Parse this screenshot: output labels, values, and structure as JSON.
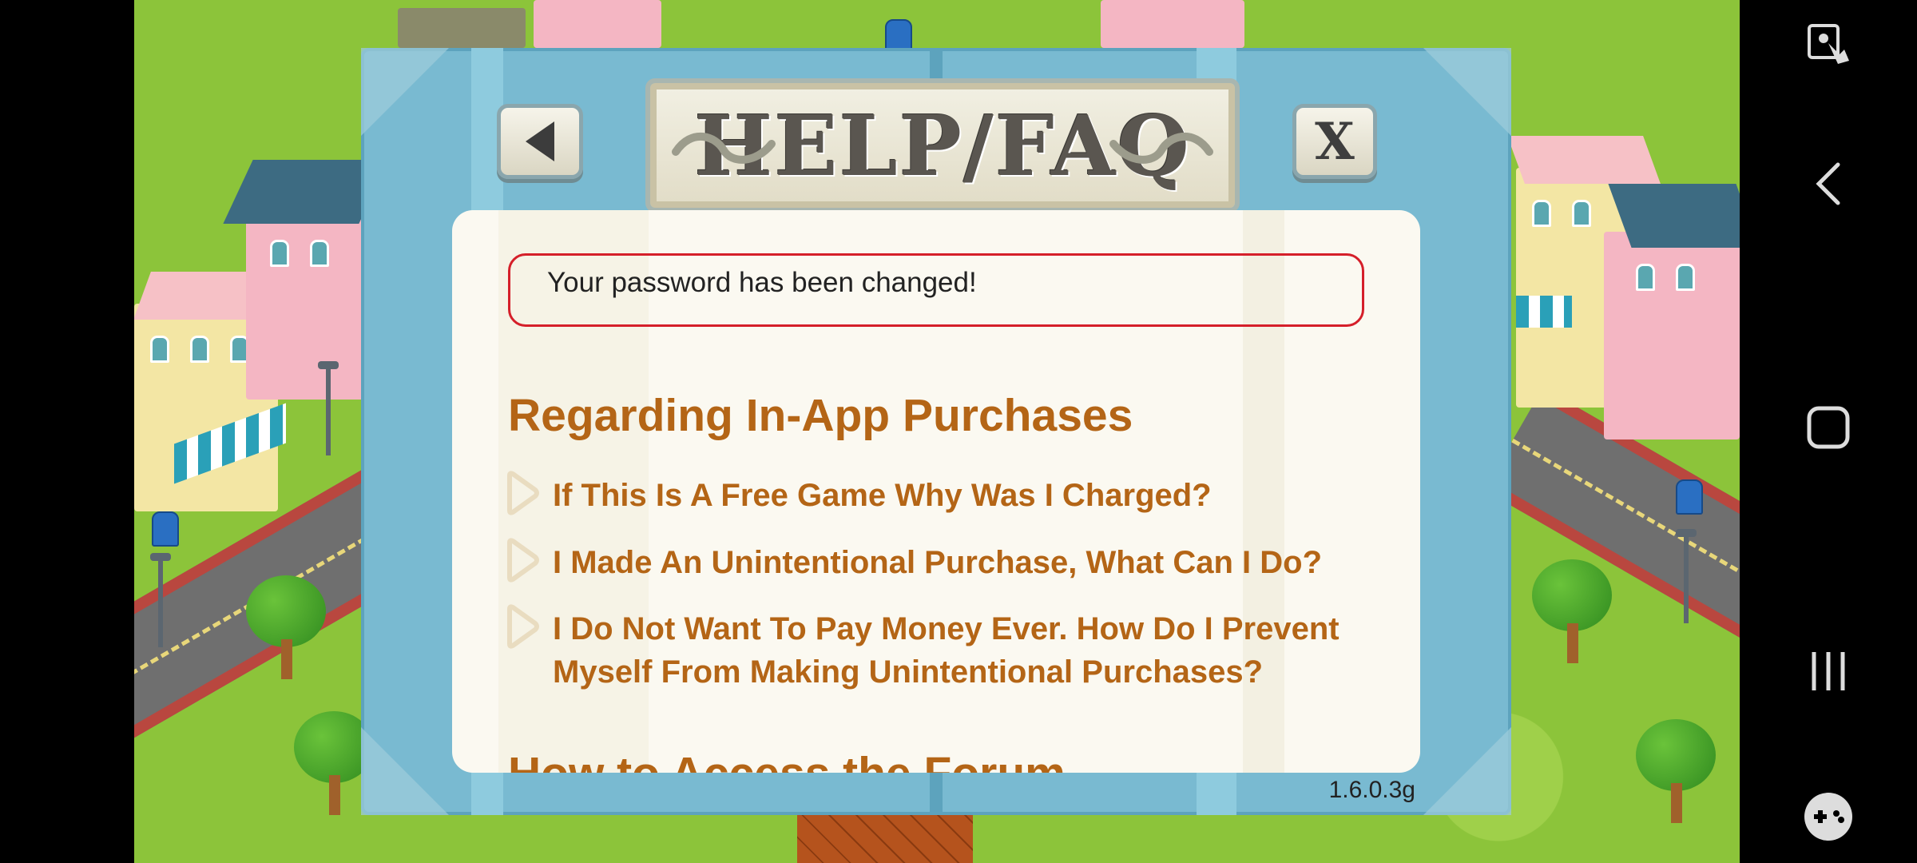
{
  "dialog": {
    "title": "HELP/FAQ",
    "close_label": "X",
    "status_message": "Your password has been changed!",
    "section_heading": "Regarding In-App Purchases",
    "next_section_heading": "How to Access the Forum",
    "faq_items": [
      {
        "label": "If This Is A Free Game Why Was I Charged?"
      },
      {
        "label": "I Made An Unintentional Purchase, What Can I Do?"
      },
      {
        "label": "I Do Not Want To Pay Money Ever. How Do I Prevent Myself From Making Unintentional Purchases?"
      }
    ],
    "version": "1.6.0.3g"
  },
  "colors": {
    "heading": "#b46516",
    "status_border": "#d51f2a",
    "panel": "#79bad1"
  },
  "navbar": {
    "icons": [
      "screen-lock-icon",
      "back-chevron-icon",
      "home-square-icon",
      "recents-icon",
      "game-controller-icon"
    ]
  }
}
